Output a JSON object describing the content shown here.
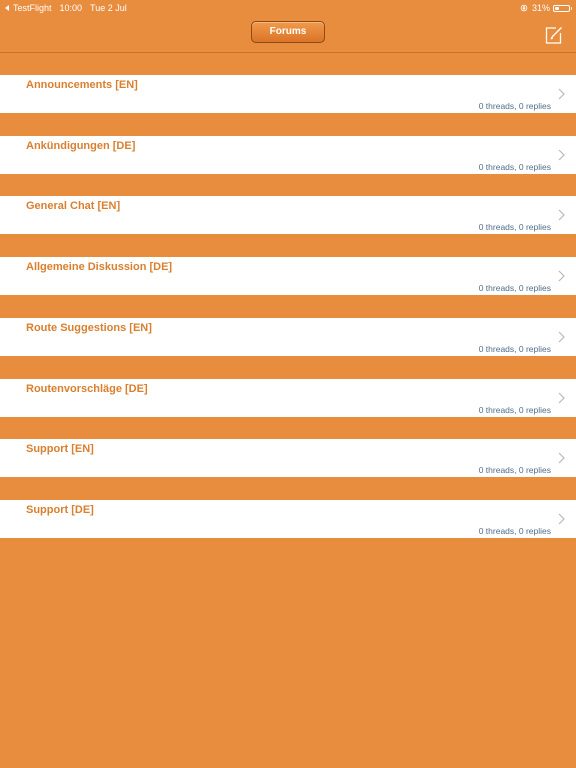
{
  "status_bar": {
    "back_app": "TestFlight",
    "time": "10:00",
    "date": "Tue 2 Jul",
    "battery_percent": "31%",
    "battery_level": 0.31,
    "icons": [
      "back-arrow-icon",
      "rotation-lock-icon",
      "battery-icon"
    ]
  },
  "nav": {
    "title_button": "Forums",
    "compose_icon": "compose-icon"
  },
  "forums": [
    {
      "title": "Announcements [EN]",
      "stats": "0 threads, 0 replies"
    },
    {
      "title": "Ankündigungen [DE]",
      "stats": "0 threads, 0 replies"
    },
    {
      "title": "General Chat [EN]",
      "stats": "0 threads, 0 replies"
    },
    {
      "title": "Allgemeine Diskussion [DE]",
      "stats": "0 threads, 0 replies"
    },
    {
      "title": "Route Suggestions [EN]",
      "stats": "0 threads, 0 replies"
    },
    {
      "title": "Routenvorschläge [DE]",
      "stats": "0 threads, 0 replies"
    },
    {
      "title": "Support [EN]",
      "stats": "0 threads, 0 replies"
    },
    {
      "title": "Support [DE]",
      "stats": "0 threads, 0 replies"
    }
  ],
  "colors": {
    "background": "#E88C3E",
    "row_background": "#FFFFFF",
    "title_text": "#D97F2E",
    "stats_text": "#4F6E8C",
    "chevron": "#B8B8BE"
  }
}
